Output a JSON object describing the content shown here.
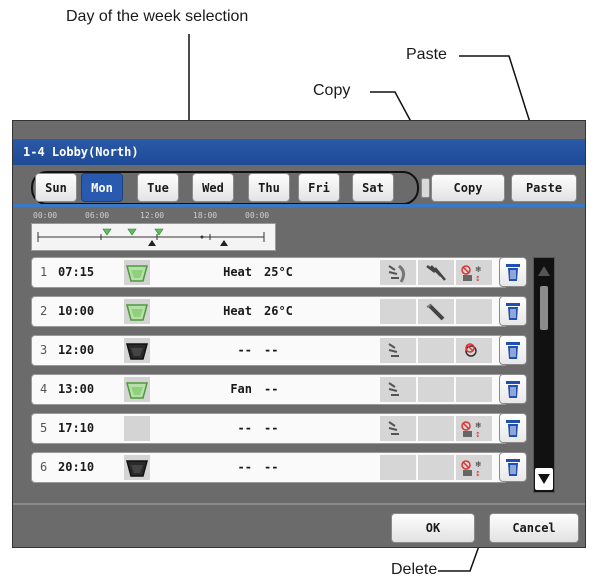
{
  "callouts": {
    "day_selection": "Day of the week selection",
    "paste": "Paste",
    "copy": "Copy",
    "delete": "Delete"
  },
  "window": {
    "title": "1-4 Lobby(North)",
    "days": [
      "Sun",
      "Mon",
      "Tue",
      "Wed",
      "Thu",
      "Fri",
      "Sat"
    ],
    "selected_day": "Mon",
    "copy_label": "Copy",
    "paste_label": "Paste",
    "ok_label": "OK",
    "cancel_label": "Cancel",
    "timeline_ticks": [
      "00:00",
      "06:00",
      "12:00",
      "18:00",
      "00:00"
    ]
  },
  "schedule": [
    {
      "num": "1",
      "time": "07:15",
      "unit": "on",
      "mode": "Heat",
      "temp": "25°C"
    },
    {
      "num": "2",
      "time": "10:00",
      "unit": "on",
      "mode": "Heat",
      "temp": "26°C"
    },
    {
      "num": "3",
      "time": "12:00",
      "unit": "off",
      "mode": "--",
      "temp": "--"
    },
    {
      "num": "4",
      "time": "13:00",
      "unit": "on",
      "mode": "Fan",
      "temp": "--"
    },
    {
      "num": "5",
      "time": "17:10",
      "unit": "none",
      "mode": "--",
      "temp": "--"
    },
    {
      "num": "6",
      "time": "20:10",
      "unit": "off",
      "mode": "--",
      "temp": "--"
    }
  ],
  "colors": {
    "title_bar": "#1e4a96",
    "selected_day": "#2a5ab0",
    "delete_icon": "#1f4fb0",
    "unit_on": "#8fd07a",
    "unit_off": "#2a2a2a"
  }
}
